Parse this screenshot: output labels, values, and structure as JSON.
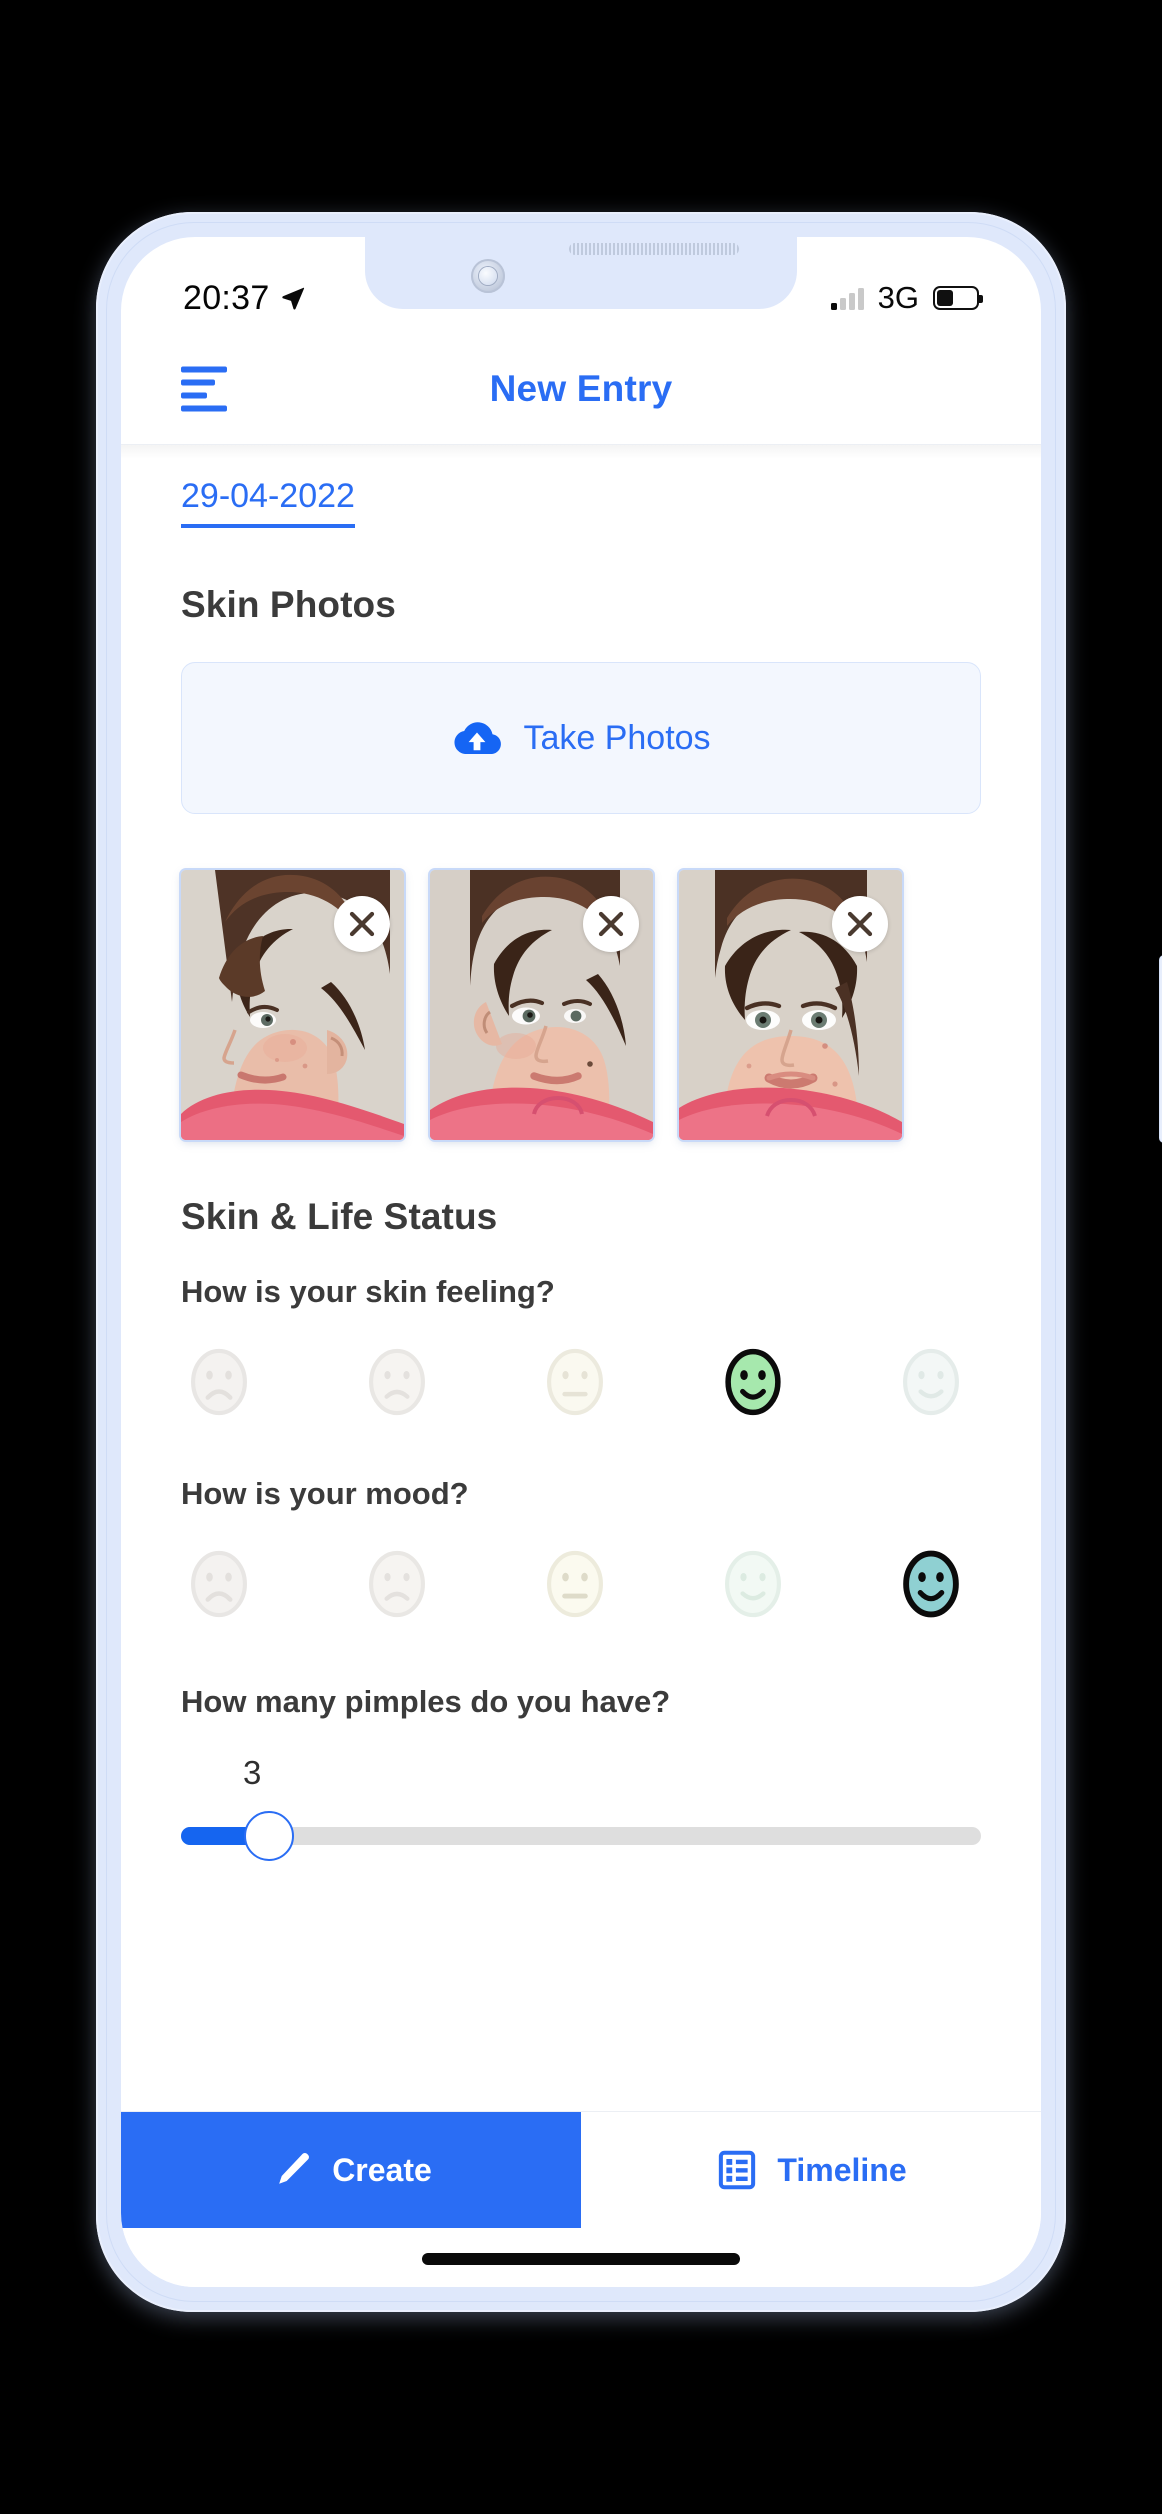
{
  "status_bar": {
    "time": "20:37",
    "location_icon": "location-arrow-icon",
    "signal_icon": "signal-bars-icon",
    "signal_bars_active": 1,
    "signal_bars_total": 4,
    "network": "3G",
    "battery_icon": "battery-icon",
    "battery_percent": 40
  },
  "navbar": {
    "menu_icon": "hamburger-menu-icon",
    "title": "New Entry"
  },
  "form": {
    "date_value": "29-04-2022",
    "photos_section_title": "Skin Photos",
    "take_photos": {
      "label": "Take Photos",
      "icon": "cloud-upload-icon"
    },
    "photos": [
      {
        "alt": "profile-left-portrait",
        "remove_icon": "close-icon"
      },
      {
        "alt": "three-quarter-portrait",
        "remove_icon": "close-icon"
      },
      {
        "alt": "front-facing-portrait",
        "remove_icon": "close-icon"
      }
    ],
    "status_section_title": "Skin & Life Status",
    "skin_question": {
      "label": "How is your skin feeling?",
      "options": [
        "very-sad",
        "sad",
        "neutral",
        "happy",
        "very-happy"
      ],
      "selected_index": 3,
      "selected_color": "#a6e8ad"
    },
    "mood_question": {
      "label": "How is your mood?",
      "options": [
        "very-sad",
        "sad",
        "neutral",
        "happy",
        "very-happy"
      ],
      "selected_index": 4,
      "selected_color": "#8fd0d2"
    },
    "pimples_question": {
      "label": "How many pimples do you have?",
      "value": "3",
      "min": 0,
      "max": 28,
      "fill_percent": 11
    }
  },
  "tabbar": {
    "tabs": [
      {
        "label": "Create",
        "icon": "pencil-icon",
        "active": true
      },
      {
        "label": "Timeline",
        "icon": "list-icon",
        "active": false
      }
    ]
  },
  "colors": {
    "accent": "#2a6df4",
    "accent_solid": "#1565f4",
    "frame": "#dfe8fb",
    "panel": "#f3f7fe",
    "text_dark": "#3b3b3b"
  }
}
